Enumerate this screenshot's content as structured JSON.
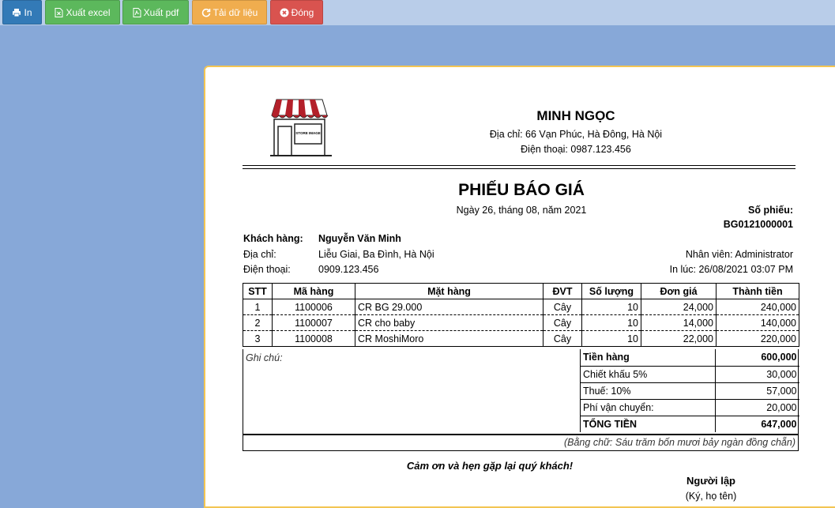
{
  "toolbar": {
    "print_label": "In",
    "excel_label": "Xuất excel",
    "pdf_label": "Xuất pdf",
    "reload_label": "Tải dữ liệu",
    "close_label": "Đóng"
  },
  "shop": {
    "name": "MINH NGỌC",
    "address": "Địa chỉ: 66 Vạn Phúc, Hà Đông, Hà Nội",
    "phone": "Điện thoại: 0987.123.456",
    "logo_text": "STORE IMAGE"
  },
  "doc": {
    "title": "PHIẾU BÁO GIÁ",
    "date": "Ngày 26, tháng 08, năm 2021",
    "number_label": "Số phiếu:",
    "number": "BG0121000001"
  },
  "customer": {
    "name_label": "Khách hàng:",
    "name": "Nguyễn Văn Minh",
    "address_label": "Địa chỉ:",
    "address": "Liễu Giai, Ba Đình, Hà Nội",
    "phone_label": "Điện thoại:",
    "phone": "0909.123.456"
  },
  "staff": {
    "employee": "Nhân viên: Administrator",
    "printed_at": "In lúc: 26/08/2021 03:07 PM"
  },
  "table": {
    "headers": [
      "STT",
      "Mã hàng",
      "Mặt hàng",
      "ĐVT",
      "Số lượng",
      "Đơn giá",
      "Thành tiền"
    ],
    "rows": [
      [
        "1",
        "1100006",
        "CR BG 29.000",
        "Cây",
        "10",
        "24,000",
        "240,000"
      ],
      [
        "2",
        "1100007",
        "CR cho baby",
        "Cây",
        "10",
        "14,000",
        "140,000"
      ],
      [
        "3",
        "1100008",
        "CR MoshiMoro",
        "Cây",
        "10",
        "22,000",
        "220,000"
      ]
    ]
  },
  "summary": {
    "note_label": "Ghi chú:",
    "subtotal_label": "Tiền hàng",
    "subtotal": "600,000",
    "discount_label": "Chiết khấu 5%",
    "discount": "30,000",
    "tax_label": "Thuế: 10%",
    "tax": "57,000",
    "shipping_label": "Phí vận chuyển:",
    "shipping": "20,000",
    "total_label": "TỔNG TIỀN",
    "total": "647,000",
    "in_words": "(Bằng chữ: Sáu trăm bốn mươi bảy ngàn đồng chẵn)"
  },
  "footer": {
    "thanks": "Cảm ơn và hẹn gặp lại quý khách!",
    "signer_title": "Người lập",
    "signer_note": "(Ký, họ tên)"
  }
}
